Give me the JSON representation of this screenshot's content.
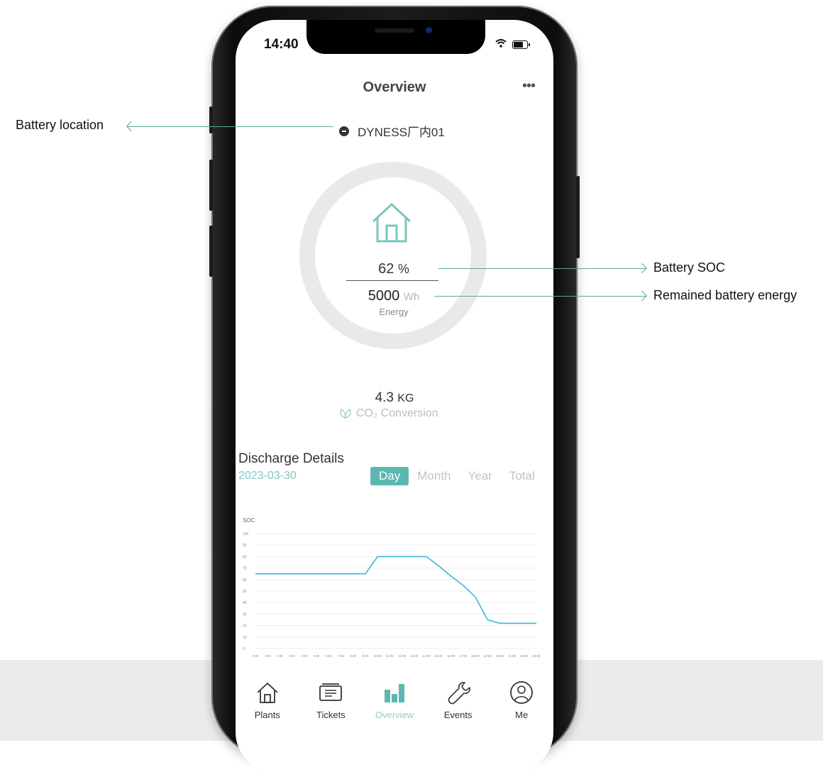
{
  "annotations": {
    "location": "Battery location",
    "soc": "Battery SOC",
    "energy": "Remained battery energy"
  },
  "status_bar": {
    "time": "14:40"
  },
  "header": {
    "title": "Overview",
    "more": "•••"
  },
  "location": {
    "name": "DYNESS厂内01"
  },
  "soc": {
    "value": "62",
    "unit": "%"
  },
  "energy": {
    "value": "5000",
    "unit": "Wh",
    "label": "Energy"
  },
  "co2": {
    "value": "4.3",
    "unit": "KG",
    "label": "CO₂ Conversion"
  },
  "discharge": {
    "title": "Discharge Details",
    "date": "2023-03-30",
    "tabs": [
      "Day",
      "Month",
      "Year",
      "Total"
    ],
    "active_tab": "Day"
  },
  "chart_data": {
    "type": "line",
    "ylabel": "SOC",
    "ylim": [
      0,
      80
    ],
    "yticks": [
      0,
      10,
      20,
      30,
      40,
      50,
      60,
      70,
      80,
      90,
      100
    ],
    "x": [
      "0:00",
      "1:00",
      "2:00",
      "3:00",
      "4:00",
      "5:00",
      "6:00",
      "7:00",
      "8:00",
      "9:00",
      "10:00",
      "11:00",
      "12:00",
      "13:00",
      "14:00",
      "15:00",
      "16:00",
      "17:00",
      "18:00",
      "19:00",
      "20:00",
      "21:00",
      "22:00",
      "23:00"
    ],
    "series": [
      {
        "values": [
          65,
          65,
          65,
          65,
          65,
          65,
          65,
          65,
          65,
          65,
          80,
          80,
          80,
          80,
          80,
          72,
          63,
          55,
          45,
          25,
          22,
          22,
          22,
          22
        ]
      }
    ],
    "colors": {
      "line": "#3bb6d8",
      "grid": "#eeeeee"
    }
  },
  "tabbar": {
    "items": [
      {
        "label": "Plants",
        "icon": "home-icon"
      },
      {
        "label": "Tickets",
        "icon": "ticket-icon"
      },
      {
        "label": "Overview",
        "icon": "bar-chart-icon"
      },
      {
        "label": "Events",
        "icon": "wrench-icon"
      },
      {
        "label": "Me",
        "icon": "user-icon"
      }
    ],
    "active": "Overview"
  },
  "colors": {
    "accent": "#5bb8b0",
    "annotation_line": "#5aa894"
  }
}
